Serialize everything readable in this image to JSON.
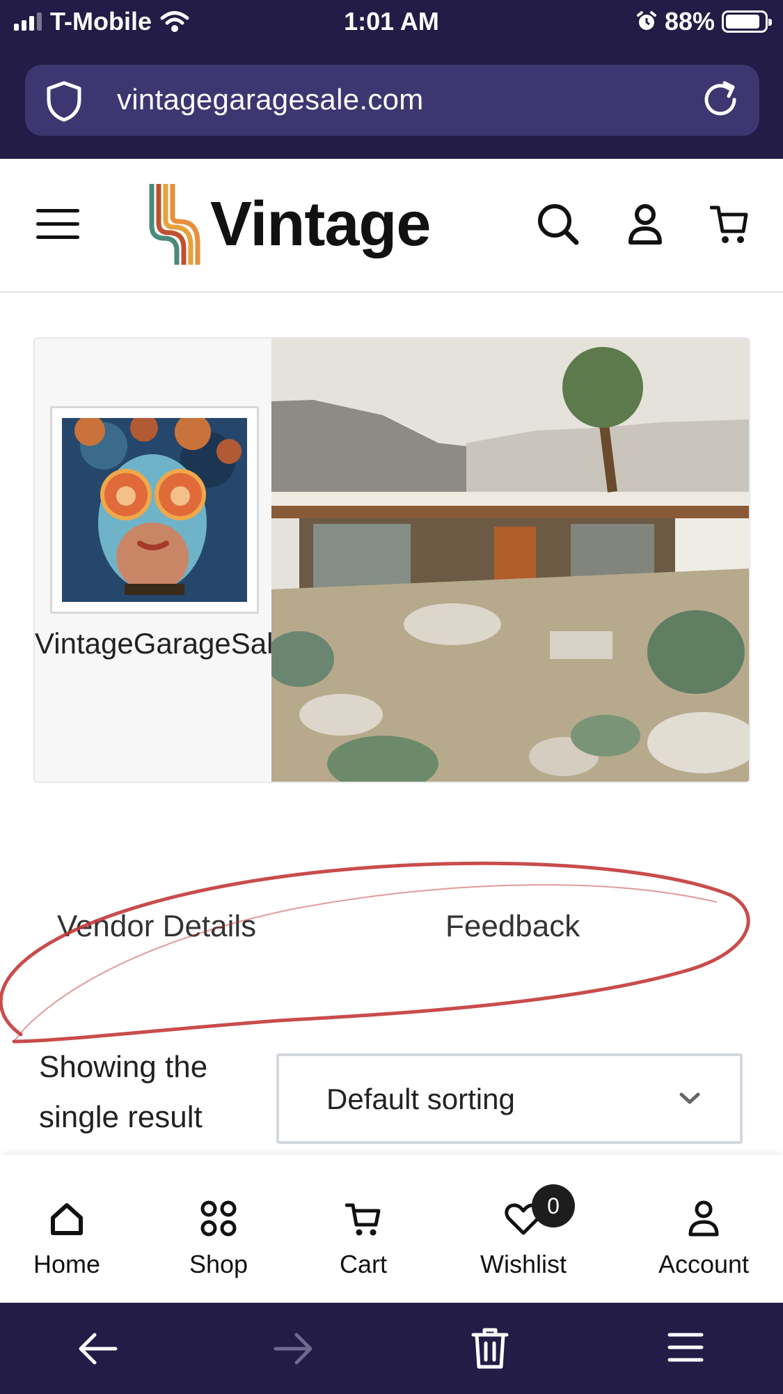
{
  "status_bar": {
    "carrier": "T-Mobile",
    "time": "1:01 AM",
    "battery": "88%"
  },
  "browser": {
    "url": "vintagegaragesale.com"
  },
  "header": {
    "brand": "Vintage",
    "icons": [
      "menu-icon",
      "search-icon",
      "user-icon",
      "cart-icon"
    ]
  },
  "vendor": {
    "name": "VintageGarageSale"
  },
  "tabs": [
    {
      "label": "Vendor Details"
    },
    {
      "label": "Feedback"
    }
  ],
  "shop": {
    "result_count": "Showing the single result",
    "sort_selected": "Default sorting"
  },
  "bottom_nav": {
    "items": [
      {
        "label": "Home",
        "icon": "home-icon"
      },
      {
        "label": "Shop",
        "icon": "shop-icon"
      },
      {
        "label": "Cart",
        "icon": "cart-icon"
      },
      {
        "label": "Wishlist",
        "icon": "heart-icon",
        "badge": "0"
      },
      {
        "label": "Account",
        "icon": "user-icon"
      }
    ]
  },
  "colors": {
    "chrome": "#231c46",
    "url_bar": "#3d3670",
    "annotation": "#c0392b"
  }
}
